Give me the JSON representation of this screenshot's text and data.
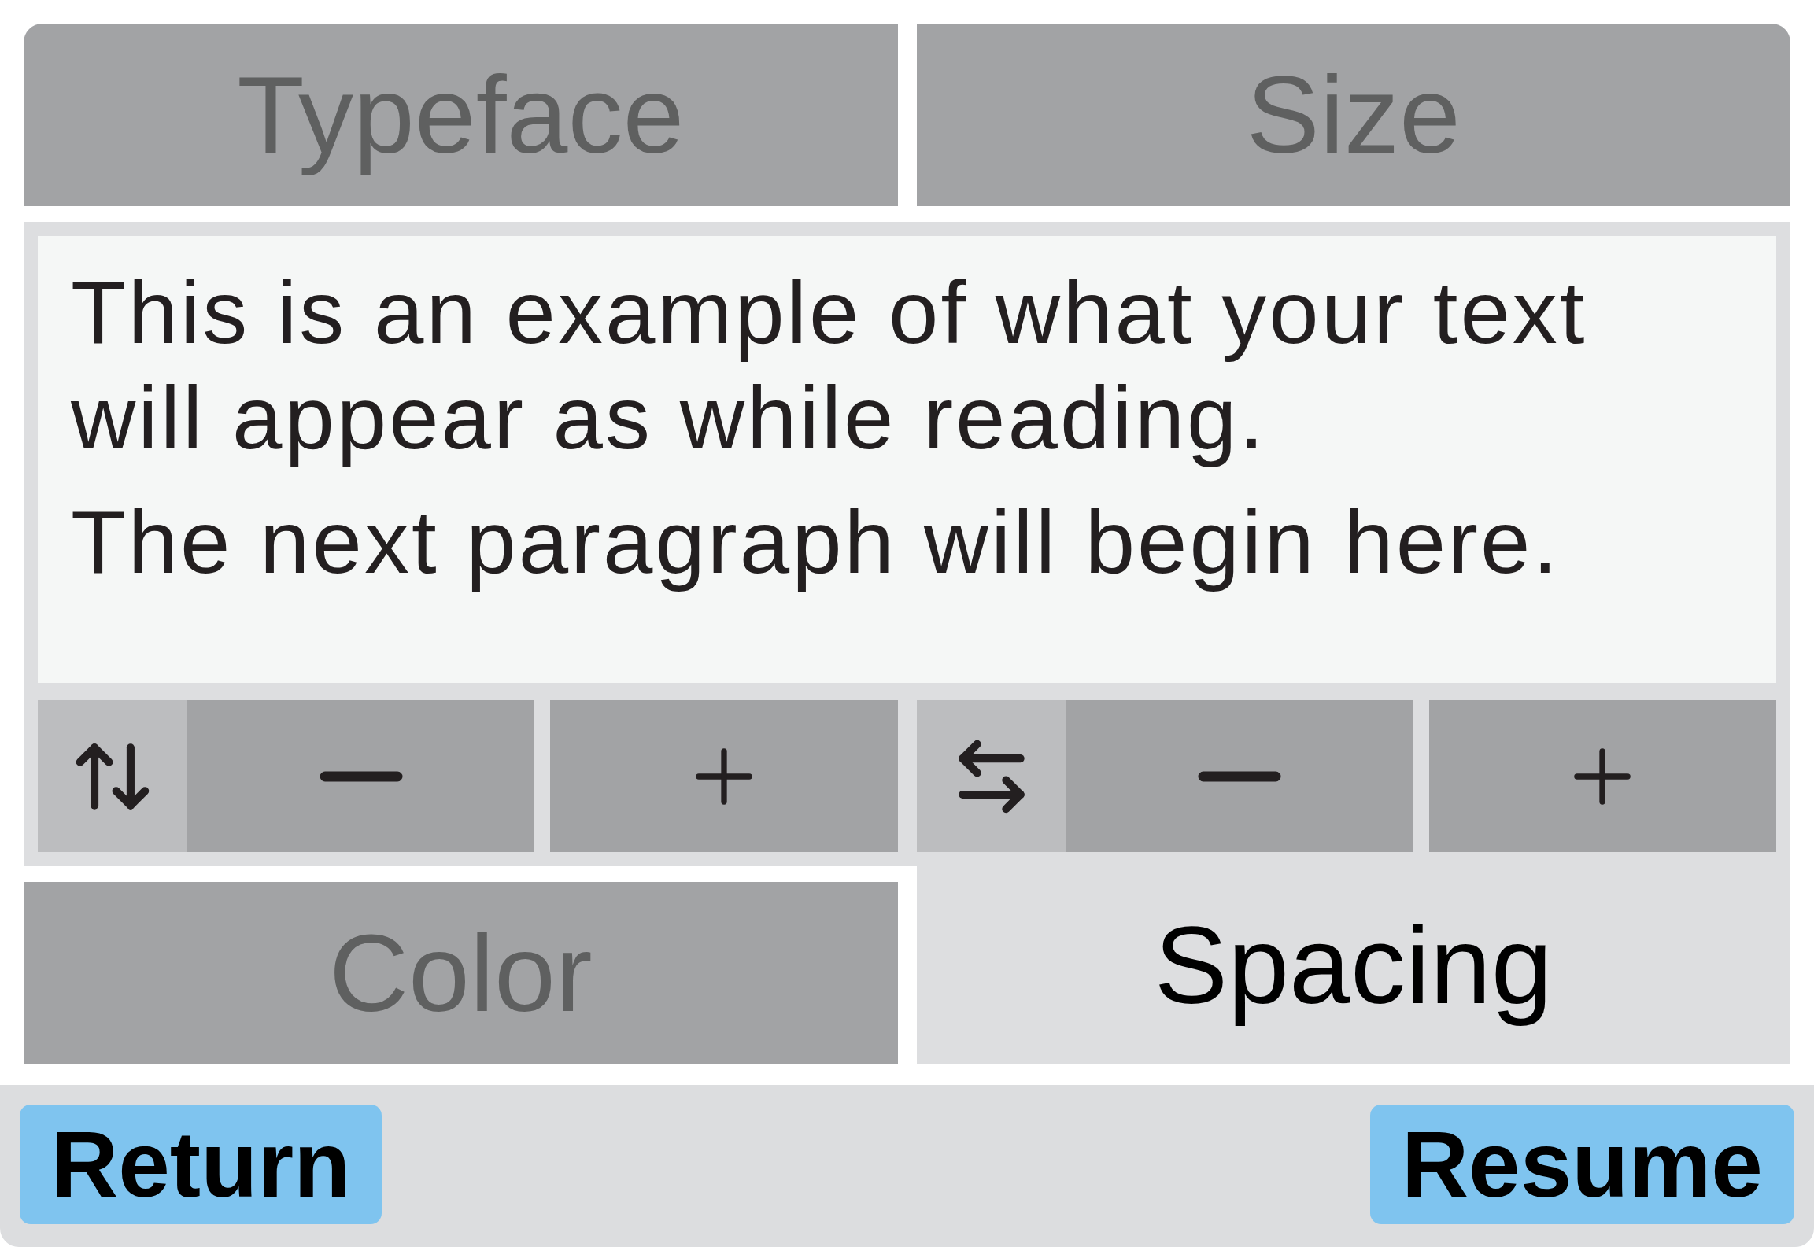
{
  "top_tabs": [
    {
      "label": "Typeface",
      "selected": false
    },
    {
      "label": "Size",
      "selected": false
    }
  ],
  "preview": {
    "paragraphs": [
      "This is an example of what your text will appear as while reading.",
      "The next paragraph will begin here."
    ]
  },
  "controls": [
    {
      "kind": "vertical"
    },
    {
      "kind": "horizontal"
    }
  ],
  "bottom_tabs": [
    {
      "label": "Color",
      "selected": false
    },
    {
      "label": "Spacing",
      "selected": true
    }
  ],
  "footer": {
    "buttons": [
      "Return",
      "Resume"
    ]
  }
}
